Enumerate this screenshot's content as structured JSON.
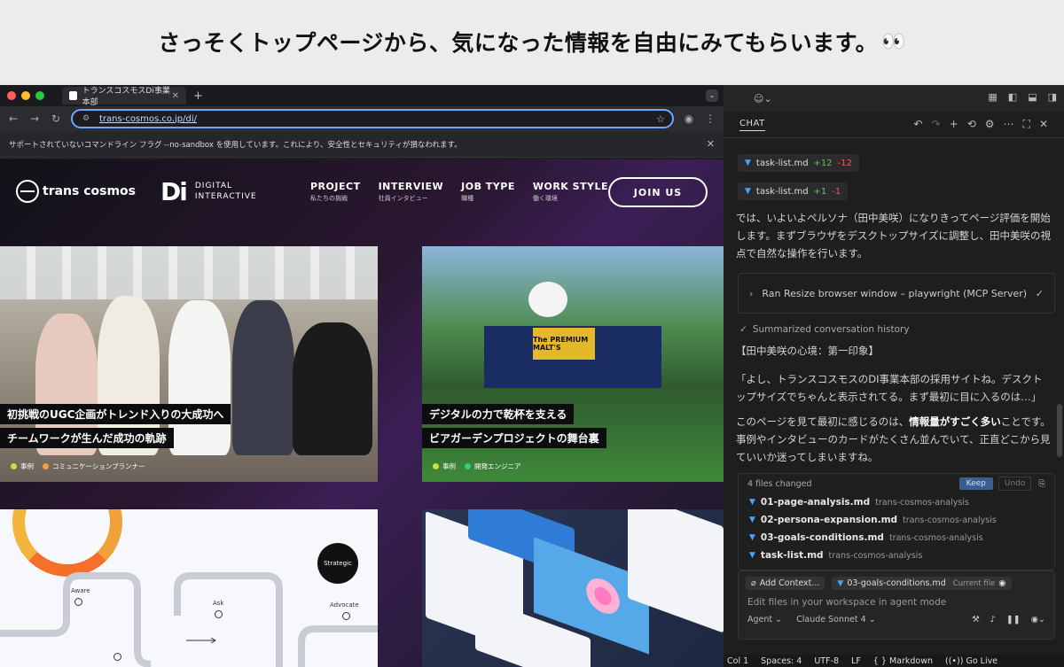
{
  "caption": {
    "text": "さっそくトップページから、気になった情報を自由にみてもらいます。",
    "emoji": "👀"
  },
  "browser": {
    "tab_title": "トランスコスモスDi事業本部",
    "url": "trans-cosmos.co.jp/di/",
    "warning": "サポートされていないコマンドライン フラグ --no-sandbox を使用しています。これにより、安全性とセキュリティが損なわれます。"
  },
  "site": {
    "logo_main": "trans cosmos",
    "logo_di": "Di",
    "logo_digital": "DIGITAL",
    "logo_interactive": "INTERACTIVE",
    "nav": [
      {
        "label": "PROJECT",
        "sub": "私たちの挑戦"
      },
      {
        "label": "INTERVIEW",
        "sub": "社員インタビュー"
      },
      {
        "label": "JOB TYPE",
        "sub": "職種"
      },
      {
        "label": "WORK STYLE",
        "sub": "働く環境"
      }
    ],
    "join": "JOIN US",
    "card1": {
      "line1": "初挑戦のUGC企画がトレンド入りの大成功へ",
      "line2": "チームワークが生んだ成功の軌跡",
      "tag1": "事例",
      "tag2": "コミュニケーションプランナー"
    },
    "card2": {
      "line1": "デジタルの力で乾杯を支える",
      "line2": "ビアガーデンプロジェクトの舞台裏",
      "tag1": "事例",
      "tag2": "開発エンジニア",
      "sign": "The PREMIUM MALT'S"
    },
    "card3": {
      "strategic": "Strategic",
      "aware": "Aware",
      "ask": "Ask",
      "advocate": "Advocate"
    }
  },
  "chat": {
    "title": "CHAT",
    "file1": {
      "name": "task-list.md",
      "plus": "+12",
      "minus": "-12"
    },
    "file2": {
      "name": "task-list.md",
      "plus": "+1",
      "minus": "-1"
    },
    "para1": "では、いよいよペルソナ（田中美咲）になりきってページ評価を開始します。まずブラウザをデスクトップサイズに調整し、田中美咲の視点で自然な操作を行います。",
    "tool": "Ran Resize browser window – playwright (MCP Server)",
    "summary": "Summarized conversation history",
    "heading": "【田中美咲の心境：第一印象】",
    "quote": "「よし、トランスコスモスのDI事業本部の採用サイトね。デスクトップサイズでちゃんと表示されてる。まず最初に目に入るのは…」",
    "para2_a": "このページを見て最初に感じるのは、",
    "para2_b": "情報量がすごく多い",
    "para2_c": "ことです。事例やインタビューのカードがたくさん並んでいて、正直どこから見ていいか迷ってしまいますね。",
    "files_changed": "4 files changed",
    "keep": "Keep",
    "undo": "Undo",
    "files": [
      {
        "name": "01-page-analysis.md",
        "dir": "trans-cosmos-analysis"
      },
      {
        "name": "02-persona-expansion.md",
        "dir": "trans-cosmos-analysis"
      },
      {
        "name": "03-goals-conditions.md",
        "dir": "trans-cosmos-analysis"
      },
      {
        "name": "task-list.md",
        "dir": "trans-cosmos-analysis"
      }
    ],
    "add_context": "Add Context...",
    "current_file": "03-goals-conditions.md",
    "current_file_label": "Current file",
    "placeholder": "Edit files in your workspace in agent mode",
    "mode": "Agent",
    "model": "Claude Sonnet 4"
  },
  "status": {
    "col": "Col 1",
    "spaces": "Spaces: 4",
    "encoding": "UTF-8",
    "eol": "LF",
    "lang": "Markdown",
    "golive": "Go Live"
  },
  "colors": {
    "accent": "#6ea7ff",
    "keep": "#3a5f8f",
    "plus": "#6bbf59",
    "minus": "#f1595b"
  }
}
